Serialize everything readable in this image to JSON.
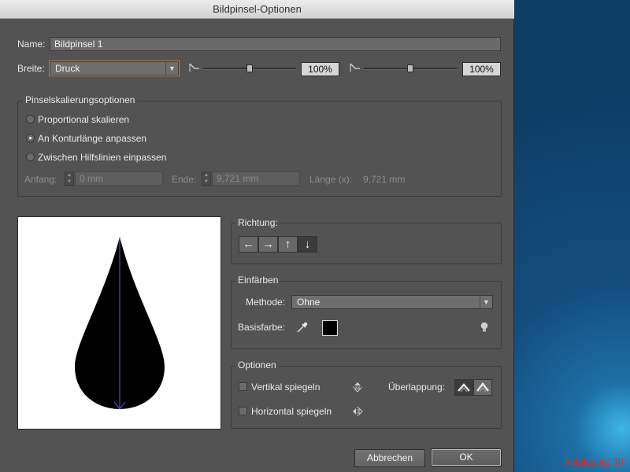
{
  "window": {
    "title": "Bildpinsel-Optionen"
  },
  "name_field": {
    "label": "Name:",
    "value": "Bildpinsel 1"
  },
  "width_row": {
    "label": "Breite:",
    "select_value": "Druck",
    "min_percent": "100%",
    "max_percent": "100%",
    "min_slider_fraction": 0.5,
    "max_slider_fraction": 0.5
  },
  "scaling": {
    "title": "Pinselskalierungsoptionen",
    "options": [
      {
        "label": "Proportional skalieren",
        "selected": false
      },
      {
        "label": "An Konturlänge anpassen",
        "selected": true
      },
      {
        "label": "Zwischen Hilfslinien einpassen",
        "selected": false
      }
    ],
    "start_label": "Anfang:",
    "start_value": "0 mm",
    "end_label": "Ende:",
    "end_value": "9,721 mm",
    "length_label": "Länge (x):",
    "length_value": "9,721 mm"
  },
  "direction": {
    "title": "Richtung:",
    "buttons": [
      "←",
      "→",
      "↑",
      "↓"
    ],
    "selected_index": 3
  },
  "colorize": {
    "title": "Einfärben",
    "method_label": "Methode:",
    "method_value": "Ohne",
    "base_color_label": "Basisfarbe:",
    "base_color": "#000000"
  },
  "options": {
    "title": "Optionen",
    "flip_vertical_label": "Vertikal spiegeln",
    "flip_horizontal_label": "Horizontal spiegeln",
    "overlap_label": "Überlappung:"
  },
  "buttons": {
    "cancel": "Abbrechen",
    "ok": "OK"
  },
  "caption": "Abbildung: 30",
  "colors": {
    "dialog_bg": "#535353",
    "caption": "#e52b1f",
    "accent_focus": "#e07b2a"
  }
}
